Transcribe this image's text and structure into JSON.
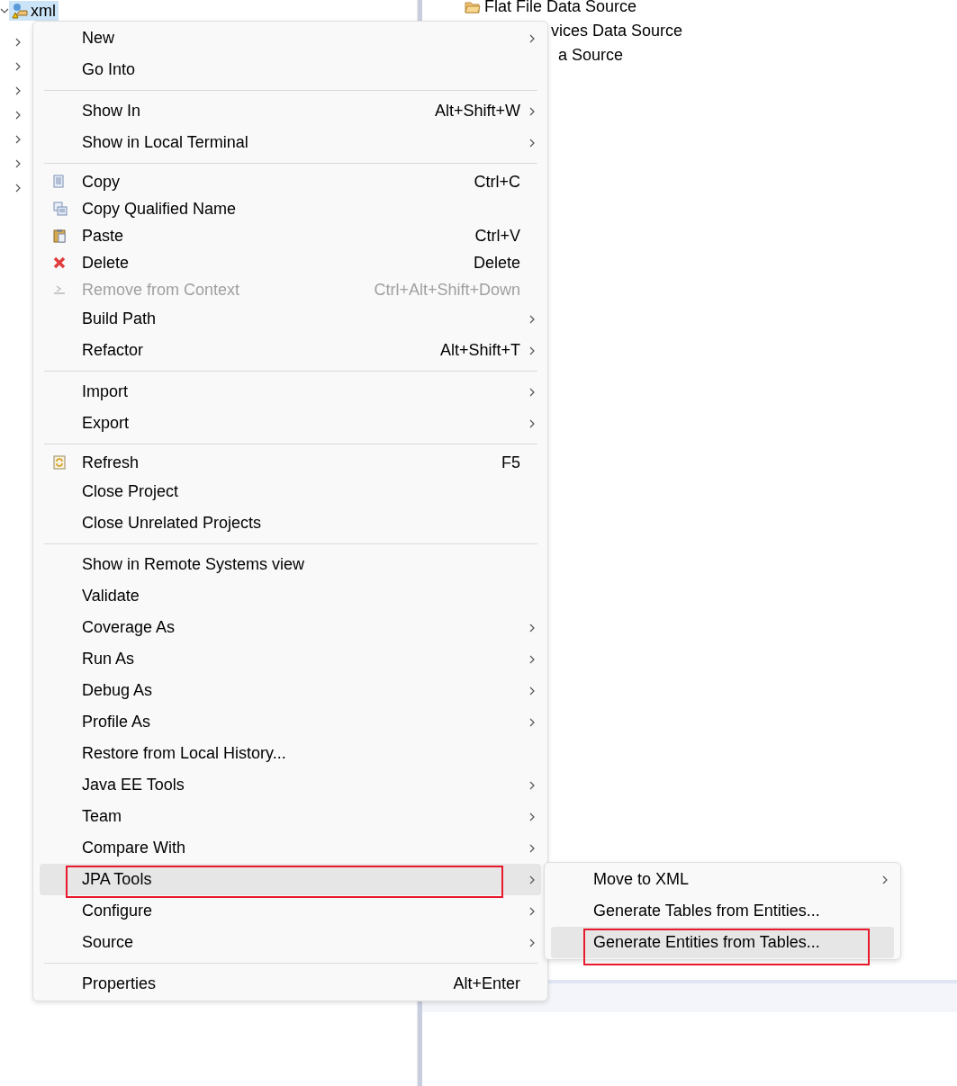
{
  "project_tree": {
    "items": [
      {
        "label": "xml",
        "expanded": true,
        "selected": true,
        "children": [
          {
            "expanded": false
          },
          {
            "expanded": false
          },
          {
            "expanded": false
          },
          {
            "expanded": false
          },
          {
            "expanded": false
          },
          {
            "expanded": false
          },
          {
            "expanded": false
          }
        ]
      }
    ]
  },
  "data_sources": [
    {
      "label": "Flat File Data Source"
    },
    {
      "label": "vices Data Source"
    },
    {
      "label": "a Source"
    }
  ],
  "context_menu": {
    "groups": [
      {
        "items": [
          {
            "label": "New",
            "submenu": true,
            "disabled": false,
            "selected": false,
            "annotated": false
          },
          {
            "label": "Go Into",
            "submenu": false,
            "disabled": false,
            "selected": false,
            "annotated": false
          }
        ]
      },
      {
        "items": [
          {
            "label": "Show In",
            "shortcut": "Alt+Shift+W",
            "submenu": true,
            "disabled": false,
            "selected": false,
            "annotated": false
          },
          {
            "label": "Show in Local Terminal",
            "submenu": true,
            "disabled": false,
            "selected": false,
            "annotated": false
          }
        ]
      },
      {
        "items": [
          {
            "label": "Copy",
            "shortcut": "Ctrl+C",
            "submenu": false,
            "disabled": false,
            "selected": false,
            "annotated": false
          },
          {
            "label": "Copy Qualified Name",
            "submenu": false,
            "disabled": false,
            "selected": false,
            "annotated": false
          },
          {
            "label": "Paste",
            "shortcut": "Ctrl+V",
            "submenu": false,
            "disabled": false,
            "selected": false,
            "annotated": false
          },
          {
            "label": "Delete",
            "shortcut": "Delete",
            "submenu": false,
            "disabled": false,
            "selected": false,
            "annotated": false
          },
          {
            "label": "Remove from Context",
            "shortcut": "Ctrl+Alt+Shift+Down",
            "submenu": false,
            "disabled": true,
            "selected": false,
            "annotated": false
          },
          {
            "label": "Build Path",
            "submenu": true,
            "disabled": false,
            "selected": false,
            "annotated": false
          },
          {
            "label": "Refactor",
            "shortcut": "Alt+Shift+T",
            "submenu": true,
            "disabled": false,
            "selected": false,
            "annotated": false
          }
        ]
      },
      {
        "items": [
          {
            "label": "Import",
            "submenu": true,
            "disabled": false,
            "selected": false,
            "annotated": false
          },
          {
            "label": "Export",
            "submenu": true,
            "disabled": false,
            "selected": false,
            "annotated": false
          }
        ]
      },
      {
        "items": [
          {
            "label": "Refresh",
            "shortcut": "F5",
            "submenu": false,
            "disabled": false,
            "selected": false,
            "annotated": false
          },
          {
            "label": "Close Project",
            "submenu": false,
            "disabled": false,
            "selected": false,
            "annotated": false
          },
          {
            "label": "Close Unrelated Projects",
            "submenu": false,
            "disabled": false,
            "selected": false,
            "annotated": false
          }
        ]
      },
      {
        "items": [
          {
            "label": "Show in Remote Systems view",
            "submenu": false,
            "disabled": false,
            "selected": false,
            "annotated": false
          },
          {
            "label": "Validate",
            "submenu": false,
            "disabled": false,
            "selected": false,
            "annotated": false
          },
          {
            "label": "Coverage As",
            "submenu": true,
            "disabled": false,
            "selected": false,
            "annotated": false
          },
          {
            "label": "Run As",
            "submenu": true,
            "disabled": false,
            "selected": false,
            "annotated": false
          },
          {
            "label": "Debug As",
            "submenu": true,
            "disabled": false,
            "selected": false,
            "annotated": false
          },
          {
            "label": "Profile As",
            "submenu": true,
            "disabled": false,
            "selected": false,
            "annotated": false
          },
          {
            "label": "Restore from Local History...",
            "submenu": false,
            "disabled": false,
            "selected": false,
            "annotated": false
          },
          {
            "label": "Java EE Tools",
            "submenu": true,
            "disabled": false,
            "selected": false,
            "annotated": false
          },
          {
            "label": "Team",
            "submenu": true,
            "disabled": false,
            "selected": false,
            "annotated": false
          },
          {
            "label": "Compare With",
            "submenu": true,
            "disabled": false,
            "selected": false,
            "annotated": false
          },
          {
            "label": "JPA Tools",
            "submenu": true,
            "disabled": false,
            "selected": true,
            "annotated": true
          },
          {
            "label": "Configure",
            "submenu": true,
            "disabled": false,
            "selected": false,
            "annotated": false
          },
          {
            "label": "Source",
            "submenu": true,
            "disabled": false,
            "selected": false,
            "annotated": false
          }
        ]
      },
      {
        "items": [
          {
            "label": "Properties",
            "shortcut": "Alt+Enter",
            "submenu": false,
            "disabled": false,
            "selected": false,
            "annotated": false
          }
        ]
      }
    ]
  },
  "submenu": {
    "items": [
      {
        "label": "Move to XML",
        "submenu": true,
        "disabled": false,
        "selected": false,
        "annotated": false
      },
      {
        "label": "Generate Tables from Entities...",
        "submenu": false,
        "disabled": false,
        "selected": false,
        "annotated": false
      },
      {
        "label": "Generate Entities from Tables...",
        "submenu": false,
        "disabled": false,
        "selected": true,
        "annotated": true
      }
    ]
  }
}
